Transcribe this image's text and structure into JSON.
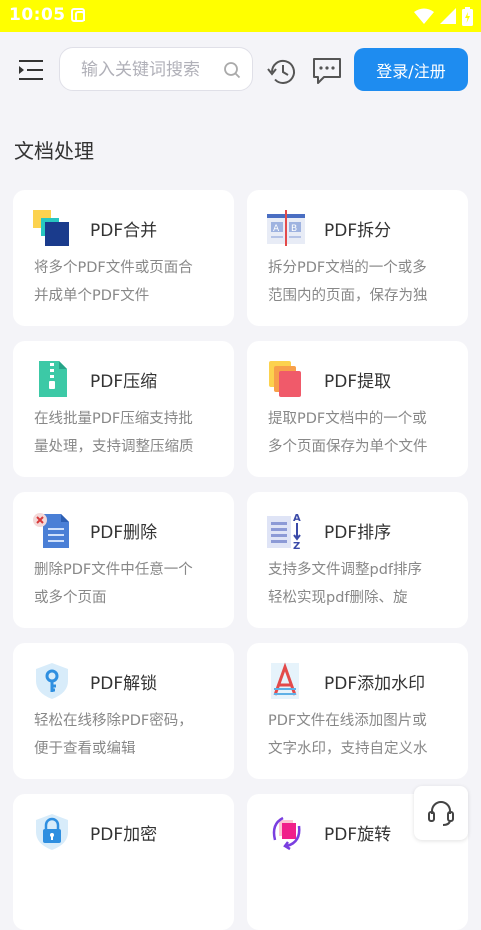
{
  "status_bar": {
    "time": "10:05"
  },
  "header": {
    "search_placeholder": "输入关键词搜索",
    "login_label": "登录/注册"
  },
  "section": {
    "title": "文档处理"
  },
  "cards": [
    {
      "title": "PDF合并",
      "desc": "将多个PDF文件或页面合\n并成单个PDF文件",
      "icon": "merge-icon"
    },
    {
      "title": "PDF拆分",
      "desc": "拆分PDF文档的一个或多\n范围内的页面，保存为独",
      "icon": "split-icon"
    },
    {
      "title": "PDF压缩",
      "desc": "在线批量PDF压缩支持批\n量处理，支持调整压缩质",
      "icon": "compress-icon"
    },
    {
      "title": "PDF提取",
      "desc": "提取PDF文档中的一个或\n多个页面保存为单个文件",
      "icon": "extract-icon"
    },
    {
      "title": "PDF删除",
      "desc": "删除PDF文件中任意一个\n或多个页面",
      "icon": "delete-icon"
    },
    {
      "title": "PDF排序",
      "desc": "支持多文件调整pdf排序\n轻松实现pdf删除、旋",
      "icon": "sort-icon"
    },
    {
      "title": "PDF解锁",
      "desc": "轻松在线移除PDF密码，\n便于查看或编辑",
      "icon": "unlock-icon"
    },
    {
      "title": "PDF添加水印",
      "desc": "PDF文件在线添加图片或\n文字水印，支持自定义水",
      "icon": "watermark-icon"
    },
    {
      "title": "PDF加密",
      "desc": "",
      "icon": "lock-icon"
    },
    {
      "title": "PDF旋转",
      "desc": "",
      "icon": "rotate-icon"
    }
  ]
}
